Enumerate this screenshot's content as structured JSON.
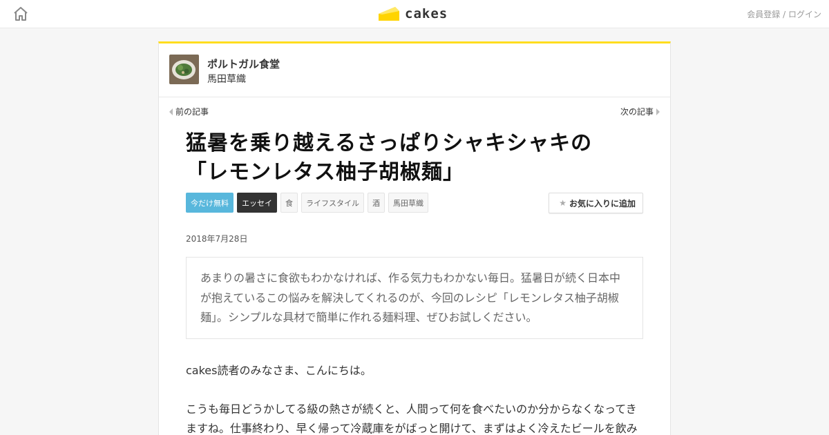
{
  "header": {
    "home_icon": "home-icon",
    "logo_text": "cakes",
    "logo_color": "#ffd400",
    "auth": {
      "register": "会員登録",
      "separator": "/",
      "login": "ログイン"
    }
  },
  "series": {
    "title": "ポルトガル食堂",
    "author": "馬田草織"
  },
  "nav": {
    "prev": "前の記事",
    "next": "次の記事"
  },
  "article": {
    "title_line1": "猛暑を乗り越えるさっぱりシャキシャキの",
    "title_line2": "「レモンレタス柚子胡椒麺」",
    "tags": [
      "今だけ無料",
      "エッセイ",
      "食",
      "ライフスタイル",
      "酒",
      "馬田草織"
    ],
    "favorite_label": "お気に入りに追加",
    "date": "2018年7月28日",
    "lead_line1": "あまりの暑さに食欲もわかなければ、作る気力もわかない毎日。猛暑日が続く日本中",
    "lead_line2": "が抱えているこの悩みを解決してくれるのが、今回のレシピ「レモンレタス柚子胡椒",
    "lead_line3": "麺」。シンプルな具材で簡単に作れる麺料理、ぜひお試しください。",
    "p1": "cakes読者のみなさま、こんにちは。",
    "p2_line1": "こうも毎日どうかしてる級の熱さが続くと、人間って何を食べたいのか分からなくなってき",
    "p2_line2": "ますね。仕事終わり、早く帰って冷蔵庫をがばっと開けて、まずはよく冷えたビールを飲み"
  },
  "colors": {
    "accent": "#ffdd1e",
    "free_tag": "#58b7dc",
    "essay_tag": "#333333"
  }
}
